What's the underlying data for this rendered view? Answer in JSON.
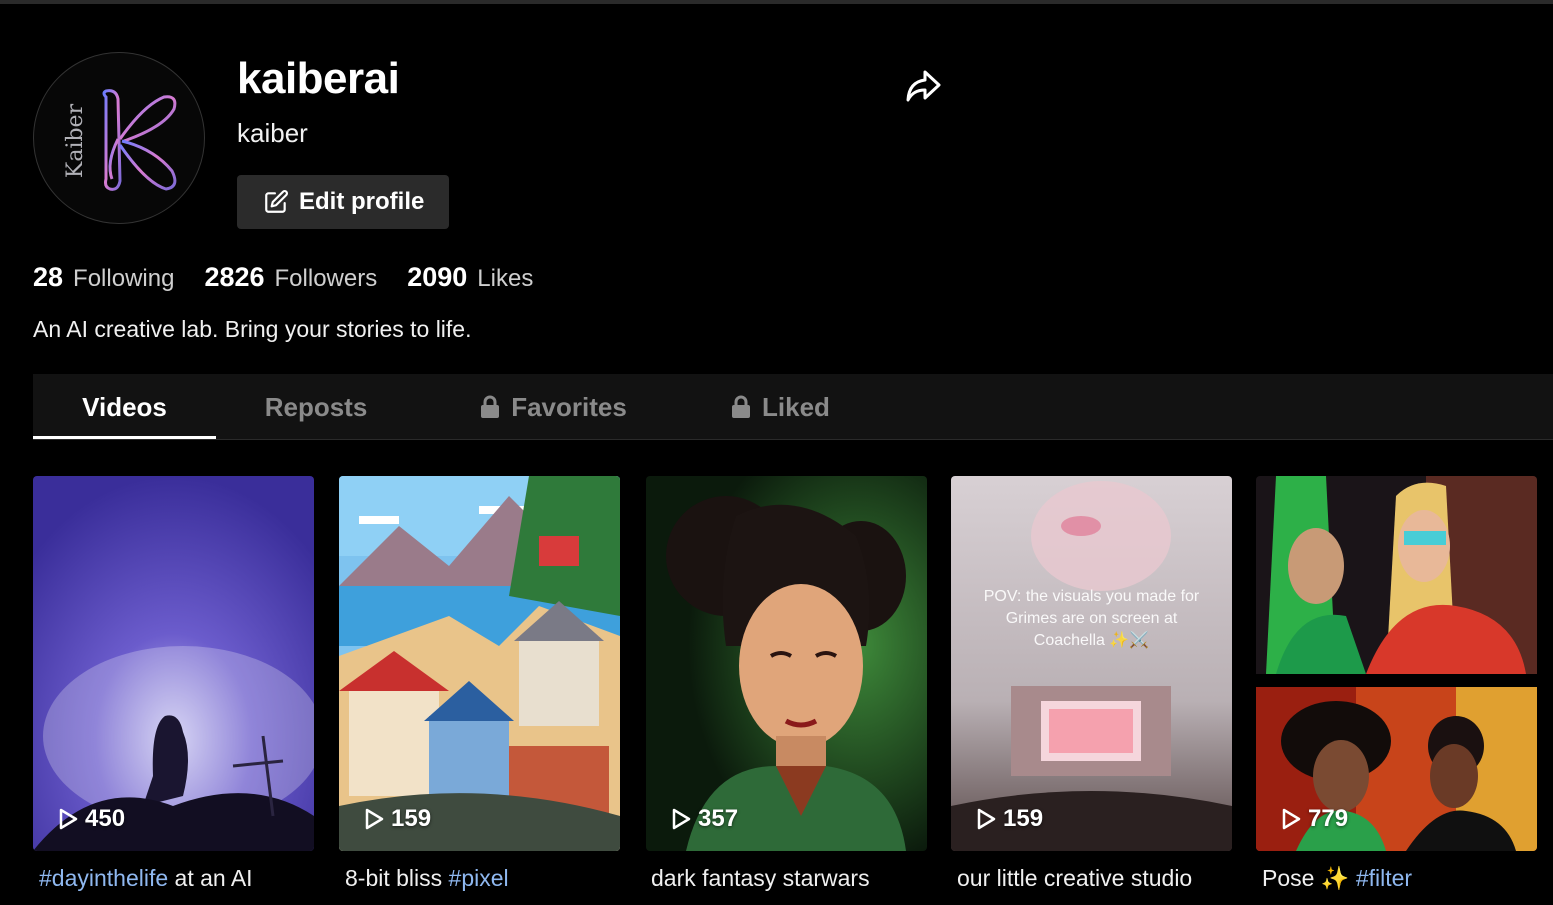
{
  "profile": {
    "username": "kaiberai",
    "nickname": "kaiber",
    "avatar_text": "Kaiber",
    "edit_label": "Edit profile",
    "bio": "An AI creative lab. Bring your stories to life."
  },
  "stats": {
    "following_count": "28",
    "following_label": "Following",
    "followers_count": "2826",
    "followers_label": "Followers",
    "likes_count": "2090",
    "likes_label": "Likes"
  },
  "tabs": [
    {
      "label": "Videos",
      "active": true,
      "locked": false
    },
    {
      "label": "Reposts",
      "active": false,
      "locked": false
    },
    {
      "label": "Favorites",
      "active": false,
      "locked": true
    },
    {
      "label": "Liked",
      "active": false,
      "locked": true
    }
  ],
  "videos": [
    {
      "views": "450",
      "hashtag": "#dayinthelife",
      "text": " at an AI"
    },
    {
      "views": "159",
      "text": "8-bit bliss ",
      "hashtag": "#pixel"
    },
    {
      "views": "357",
      "text": "dark fantasy starwars"
    },
    {
      "views": "159",
      "text": "our little creative studio",
      "overlay": "POV: the visuals you made for Grimes are on screen at Coachella ✨⚔️"
    },
    {
      "views": "779",
      "text": "Pose ✨ ",
      "hashtag": "#filter"
    }
  ],
  "icons": {
    "share": "share-icon",
    "edit": "edit-icon",
    "play": "play-icon",
    "lock": "lock-icon"
  },
  "colors": {
    "background": "#000000",
    "hashtag": "#8fb8f0",
    "button_bg": "#2b2b2b"
  }
}
